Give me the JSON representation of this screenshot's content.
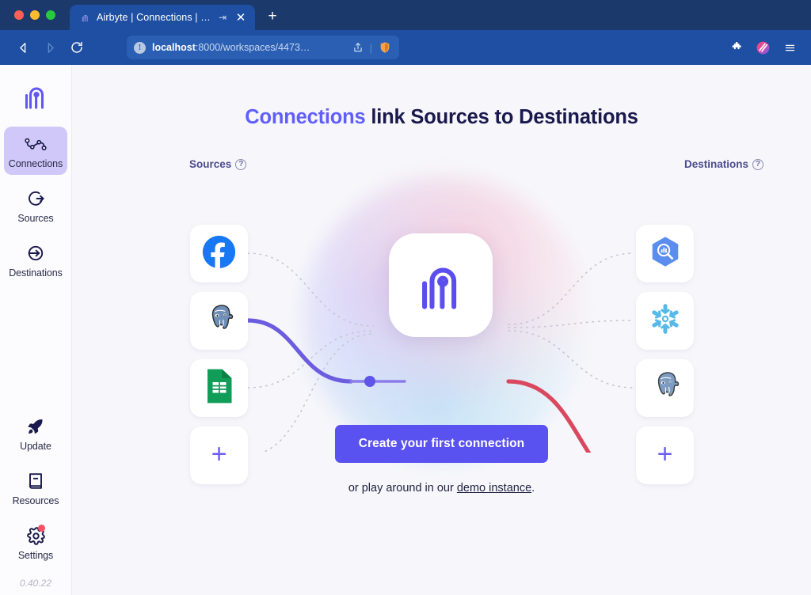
{
  "browser": {
    "tab": {
      "title": "Airbyte | Connections | Faker",
      "arrow": "⇥",
      "close": "✕",
      "favicon_name": "airbyte-favicon"
    },
    "new_tab_label": "+",
    "nav": {
      "back": "back-button",
      "forward": "forward-button",
      "reload": "reload-button"
    },
    "omnibox": {
      "info_glyph": "!",
      "url_host": "localhost",
      "url_rest": ":8000/workspaces/4473…",
      "share_icon": "share-icon",
      "separator": "|",
      "brave_icon": "brave-shields-icon"
    },
    "toolbar_right": {
      "extensions": "puzzle-piece-icon",
      "brave_rewards": "brave-rewards-icon",
      "menu": "hamburger-menu-icon"
    }
  },
  "sidebar": {
    "logo_name": "airbyte-logo",
    "items": [
      {
        "label": "Connections",
        "icon": "connections-icon",
        "active": true
      },
      {
        "label": "Sources",
        "icon": "sources-icon",
        "active": false
      },
      {
        "label": "Destinations",
        "icon": "destinations-icon",
        "active": false
      }
    ],
    "bottom_items": [
      {
        "label": "Update",
        "icon": "rocket-icon",
        "badge": false
      },
      {
        "label": "Resources",
        "icon": "book-icon",
        "badge": false
      },
      {
        "label": "Settings",
        "icon": "gear-icon",
        "badge": true
      }
    ],
    "version": "0.40.22"
  },
  "main": {
    "headline_accent": "Connections",
    "headline_rest": " link Sources to Destinations",
    "sources_label": "Sources",
    "destinations_label": "Destinations",
    "help_glyph": "?",
    "sources": [
      {
        "name": "facebook-marketing-source",
        "icon": "facebook-icon"
      },
      {
        "name": "postgres-source",
        "icon": "postgres-elephant-icon",
        "connected": true
      },
      {
        "name": "google-sheets-source",
        "icon": "google-sheets-icon"
      },
      {
        "name": "add-source",
        "icon": "plus-icon",
        "glyph": "+"
      }
    ],
    "destinations": [
      {
        "name": "bigquery-destination",
        "icon": "bigquery-icon"
      },
      {
        "name": "snowflake-destination",
        "icon": "snowflake-icon"
      },
      {
        "name": "postgres-destination",
        "icon": "postgres-elephant-icon"
      },
      {
        "name": "add-destination",
        "icon": "plus-icon",
        "glyph": "+",
        "connected": true
      }
    ],
    "hub_logo_name": "airbyte-hub-logo",
    "cta_label": "Create your first connection",
    "subtext_prefix": "or play around in our ",
    "subtext_link": "demo instance",
    "subtext_suffix": "."
  },
  "colors": {
    "accent": "#615eff",
    "cta": "#5a52f0",
    "source_line": "#6b5ce0",
    "destination_line": "#d9485f",
    "sidebar_active": "#cfc8f8",
    "badge": "#ff4f64",
    "page_bg": "#f7f7fb",
    "chrome_bg": "#1e4fa3"
  }
}
